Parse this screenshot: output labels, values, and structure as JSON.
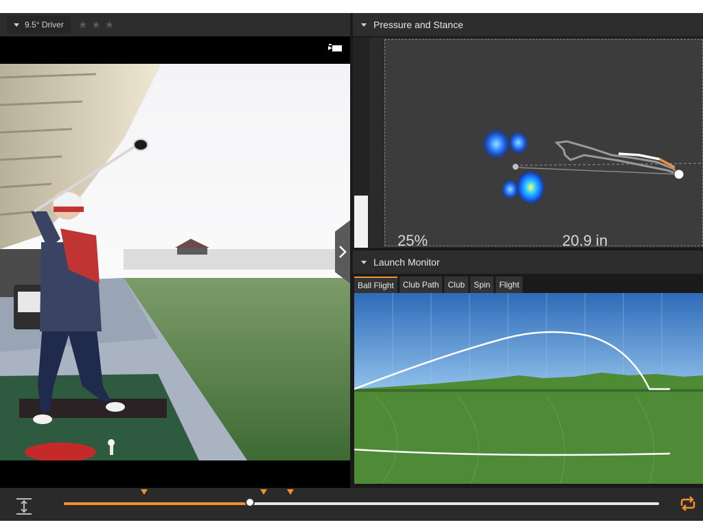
{
  "left_panel": {
    "club_label": "9.5° Driver",
    "stars": [
      "★",
      "★",
      "★"
    ],
    "camera_icon": "video-camera-icon",
    "collapse_icon": "chevron-right-icon"
  },
  "pressure_panel": {
    "title": "Pressure and Stance",
    "bar_level": 0.25,
    "percent_label": "25%",
    "distance_label": "20.9 in"
  },
  "launch_panel": {
    "title": "Launch Monitor",
    "tabs": [
      "Ball Flight",
      "Club Path",
      "Club",
      "Spin",
      "Flight"
    ],
    "active_tab": "Ball Flight"
  },
  "timeline": {
    "position": 0.312,
    "markers": [
      0.135,
      0.336,
      0.381
    ],
    "left_icon": "expand-vertical-icon",
    "right_icon": "loop-icon"
  },
  "colors": {
    "accent": "#f5922b",
    "panel": "#2d2d2d",
    "background": "#1a1a1a"
  }
}
